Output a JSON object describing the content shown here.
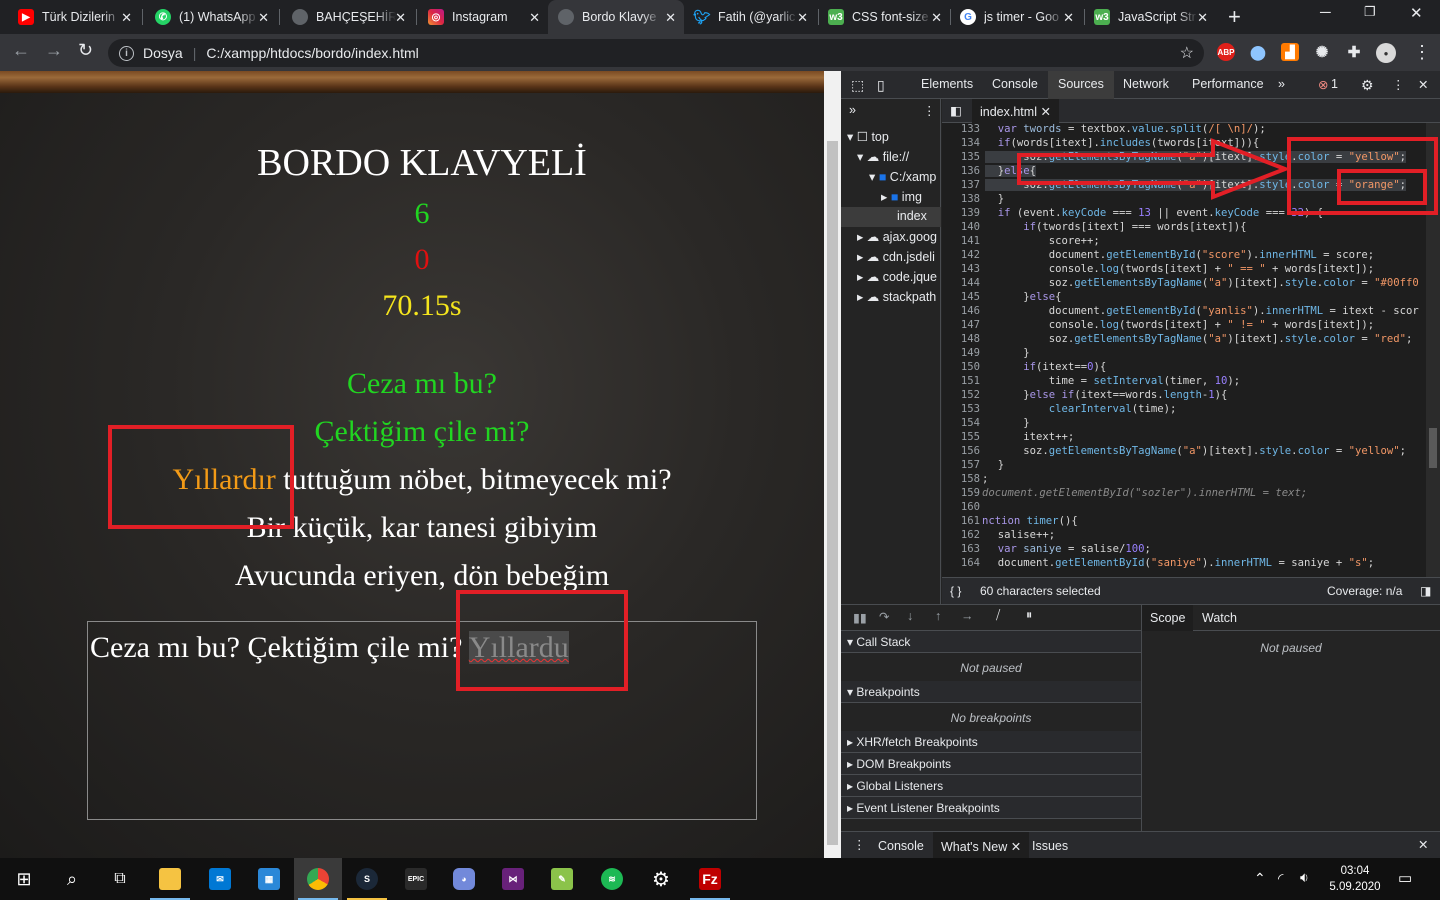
{
  "browser": {
    "tabs": [
      {
        "title": "Türk Dizilerin",
        "favicon": "youtube-icon",
        "color": "#ff0000"
      },
      {
        "title": "(1) WhatsApp",
        "favicon": "whatsapp-icon",
        "color": "#25d366"
      },
      {
        "title": "BAHÇEŞEHİR",
        "favicon": "globe-icon",
        "color": "#5f6368"
      },
      {
        "title": "Instagram",
        "favicon": "instagram-icon",
        "color": "#d6249f"
      },
      {
        "title": "Bordo Klavye",
        "favicon": "globe-icon",
        "color": "#5f6368"
      },
      {
        "title": "Fatih (@yarlic",
        "favicon": "twitter-icon",
        "color": "#1da1f2"
      },
      {
        "title": "CSS font-size",
        "favicon": "w3schools-icon",
        "color": "#4caf50"
      },
      {
        "title": "js timer - Goo",
        "favicon": "google-icon",
        "color": "#ffffff"
      },
      {
        "title": "JavaScript Str",
        "favicon": "w3schools-icon",
        "color": "#4caf50"
      }
    ],
    "active_tab": 4,
    "address": {
      "label": "Dosya",
      "url": "C:/xampp/htdocs/bordo/index.html"
    }
  },
  "page": {
    "title": "BORDO KLAVYELİ",
    "score": "6",
    "wrong": "0",
    "time": "70.15s",
    "lines": [
      "Ceza mı bu?",
      "Çektiğim çile mi?",
      "Yıllardır",
      "tuttuğum nöbet, bitmeyecek mi?",
      "Bir küçük, kar tanesi gibiyim",
      "Avucunda eriyen, dön bebeğim"
    ],
    "textbox": {
      "value": "Ceza mı bu? Çektiğim çile mi?",
      "typed": "Yıllardu"
    },
    "colors": {
      "correct": "#21d521",
      "wrong": "#e01010",
      "timer": "#f5e51d",
      "current": "#f39b17"
    }
  },
  "devtools": {
    "tabs": [
      "Elements",
      "Console",
      "Sources",
      "Network",
      "Performance"
    ],
    "active": "Sources",
    "error_count": "1",
    "tree": [
      {
        "label": "top",
        "icon": "frame-icon"
      },
      {
        "label": "file://",
        "icon": "cloud-icon"
      },
      {
        "label": "C:/xamp",
        "icon": "folder-icon"
      },
      {
        "label": "img",
        "icon": "folder-icon"
      },
      {
        "label": "index",
        "icon": "file-icon"
      },
      {
        "label": "ajax.goog",
        "icon": "cloud-icon"
      },
      {
        "label": "cdn.jsdeli",
        "icon": "cloud-icon"
      },
      {
        "label": "code.jque",
        "icon": "cloud-icon"
      },
      {
        "label": "stackpath",
        "icon": "cloud-icon"
      }
    ],
    "open_file": "index.html",
    "status": {
      "selection": "60 characters selected",
      "coverage": "Coverage: n/a"
    },
    "debugger": {
      "sections": [
        "Call Stack",
        "Breakpoints",
        "XHR/fetch Breakpoints",
        "DOM Breakpoints",
        "Global Listeners",
        "Event Listener Breakpoints"
      ],
      "not_paused": "Not paused",
      "no_breakpoints": "No breakpoints",
      "right_tabs": [
        "Scope",
        "Watch"
      ]
    },
    "drawer_tabs": [
      "Console",
      "What's New",
      "Issues"
    ]
  },
  "taskbar": {
    "time": "03:04",
    "date": "5.09.2020"
  }
}
